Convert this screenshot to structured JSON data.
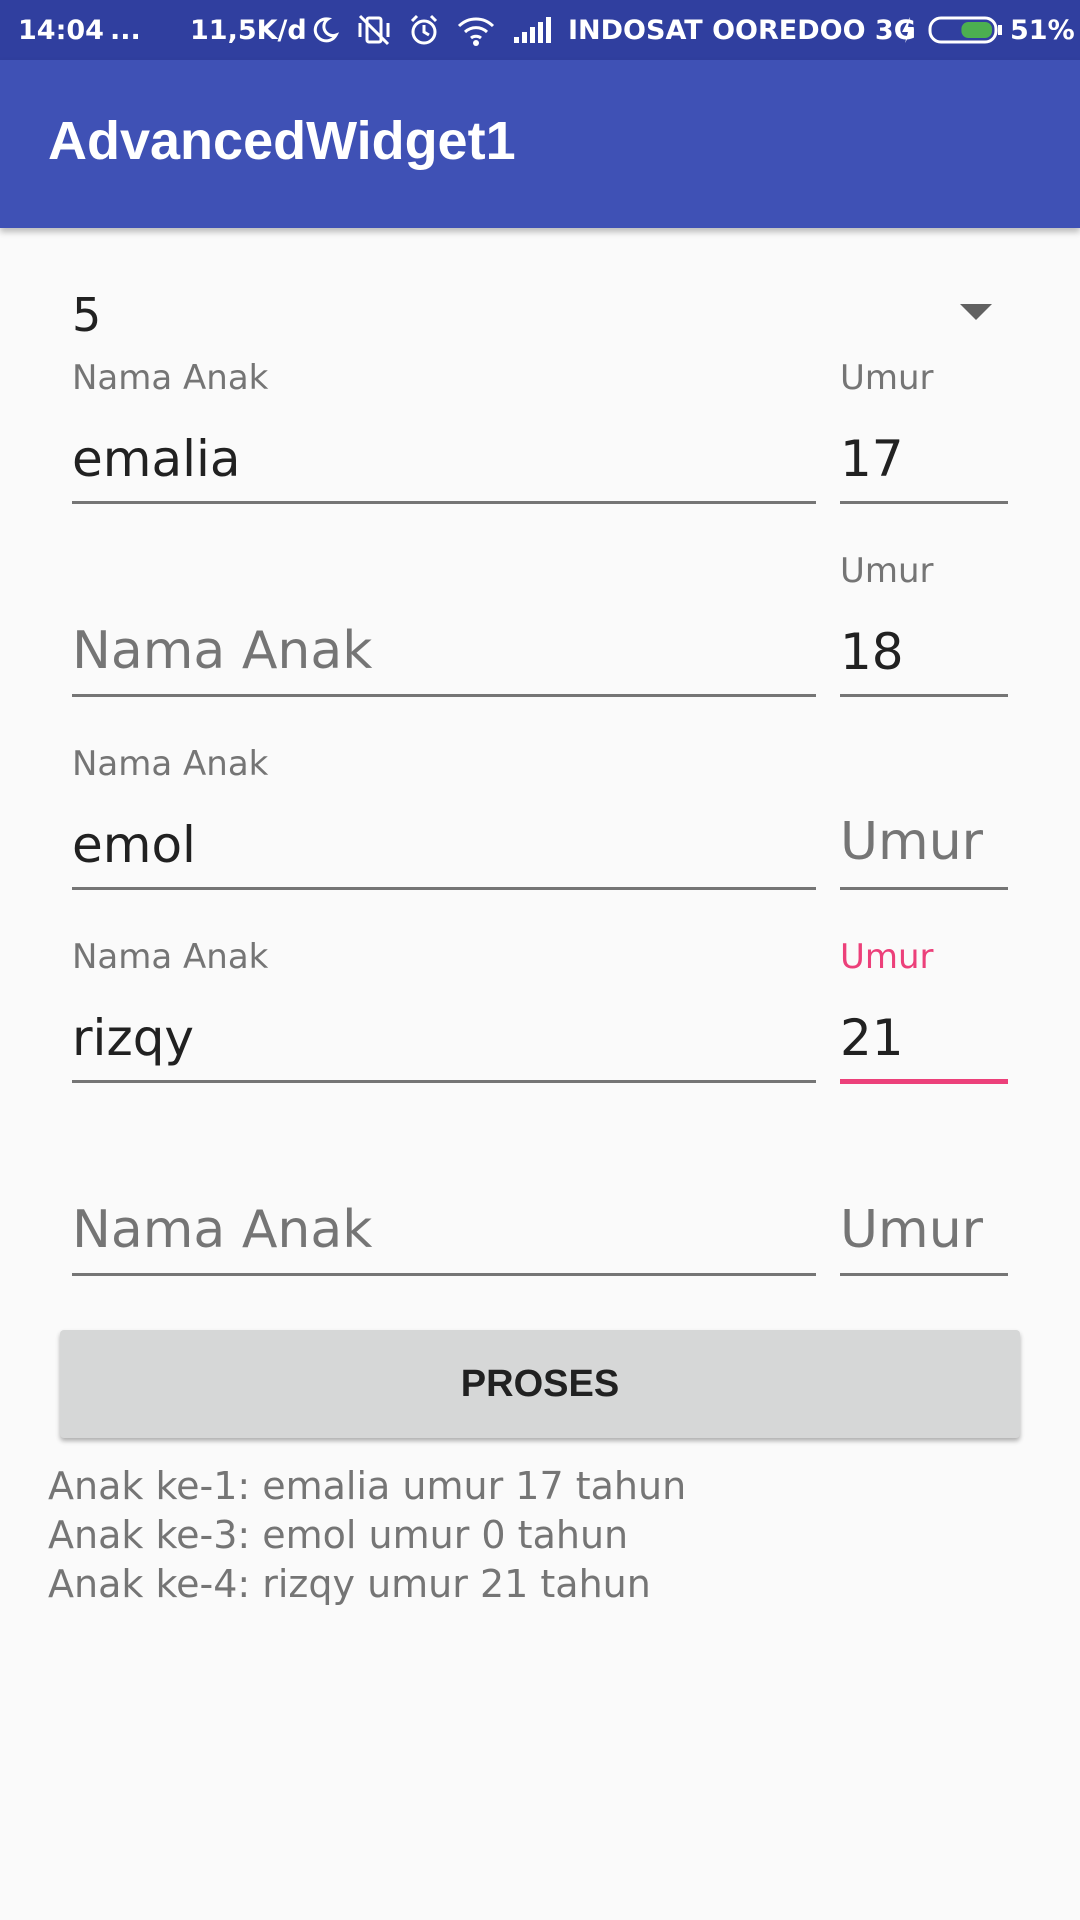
{
  "status_bar": {
    "time": "14:04",
    "dots": "...",
    "speed": "11,5K/d",
    "carrier": "INDOSAT OOREDOO 3G",
    "battery_percent": "51%",
    "battery_level": 0.51,
    "icons": [
      "moon-icon",
      "vibrate-off-icon",
      "alarm-icon",
      "wifi-icon",
      "signal-icon",
      "charging-icon",
      "battery-icon"
    ]
  },
  "app_bar": {
    "title": "AdvancedWidget1"
  },
  "spinner": {
    "value": "5"
  },
  "rows": [
    {
      "name_label": "Nama Anak",
      "name_value": "emalia",
      "umur_label": "Umur",
      "umur_value": "17"
    },
    {
      "name_placeholder": "Nama Anak",
      "umur_label": "Umur",
      "umur_value": "18"
    },
    {
      "name_label": "Nama Anak",
      "name_value": "emol",
      "umur_placeholder": "Umur"
    },
    {
      "name_label": "Nama Anak",
      "name_value": "rizqy",
      "umur_label": "Umur",
      "umur_value": "21"
    },
    {
      "name_placeholder": "Nama Anak",
      "umur_placeholder": "Umur"
    }
  ],
  "button": {
    "label": "PROSES"
  },
  "result": [
    "Anak ke-1: emalia umur 17 tahun",
    "Anak ke-3: emol umur 0 tahun",
    "Anak ke-4: rizqy umur 21 tahun"
  ],
  "colors": {
    "primary": "#3f51b5",
    "primary_dark": "#303f9f",
    "accent": "#ec407a"
  }
}
